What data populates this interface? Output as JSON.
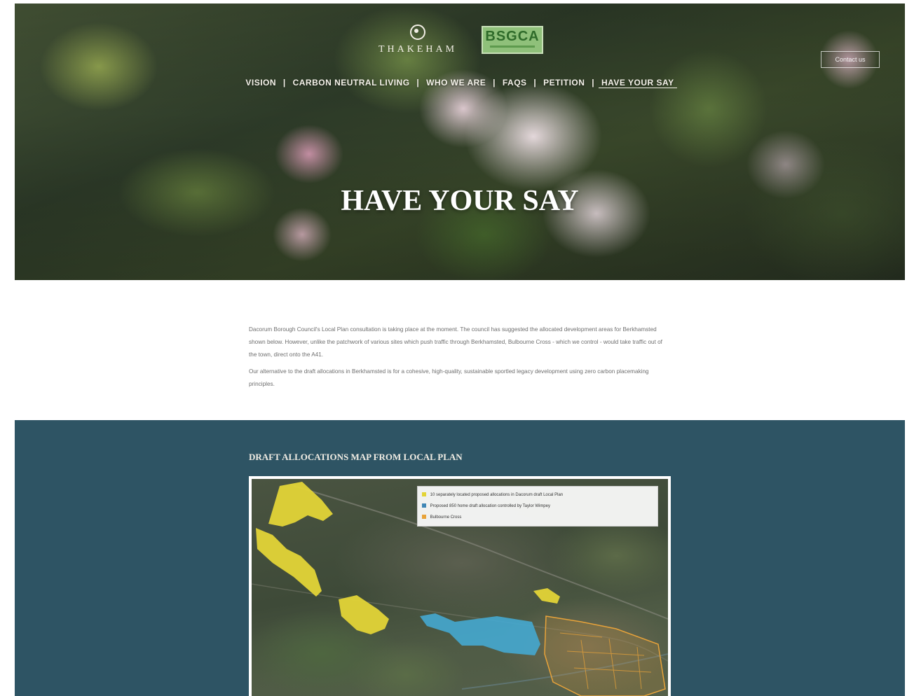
{
  "header": {
    "logo_primary": "THAKEHAM",
    "logo_secondary": "BSGCA",
    "button_label": "Contact us",
    "nav": [
      {
        "label": "VISION"
      },
      {
        "label": "CARBON NEUTRAL LIVING"
      },
      {
        "label": "WHO WE ARE"
      },
      {
        "label": "FAQS"
      },
      {
        "label": "PETITION"
      },
      {
        "label": "HAVE YOUR SAY",
        "active": true
      }
    ],
    "nav_separator": "|"
  },
  "hero": {
    "title": "HAVE YOUR SAY"
  },
  "intro": {
    "paragraphs": [
      "Dacorum Borough Council's Local Plan consultation is taking place at the moment. The council has suggested the allocated development areas for Berkhamsted shown below. However, unlike the patchwork of various sites which push traffic through Berkhamsted, Bulbourne Cross - which we control - would take traffic out of the town, direct onto the A41.",
      "Our alternative to the draft allocations in Berkhamsted is for a cohesive, high-quality, sustainable sportled legacy development using zero carbon placemaking principles."
    ]
  },
  "map_section": {
    "heading": "DRAFT ALLOCATIONS MAP FROM LOCAL PLAN",
    "legend": [
      {
        "label": "10 separately located proposed allocations in Dacorum draft Local Plan",
        "color": "#e3d437"
      },
      {
        "label": "Proposed 850 home draft allocation controlled by Taylor Wimpey",
        "color": "#3f86b5"
      },
      {
        "label": "Bulbourne Cross",
        "color": "#e8a33a"
      }
    ]
  },
  "colors": {
    "section_teal": "#2e5464",
    "allocation_yellow": "#e3d437",
    "taylor_wimpey_blue": "#45a8d0",
    "bulbourne_orange": "#e8a33a"
  }
}
